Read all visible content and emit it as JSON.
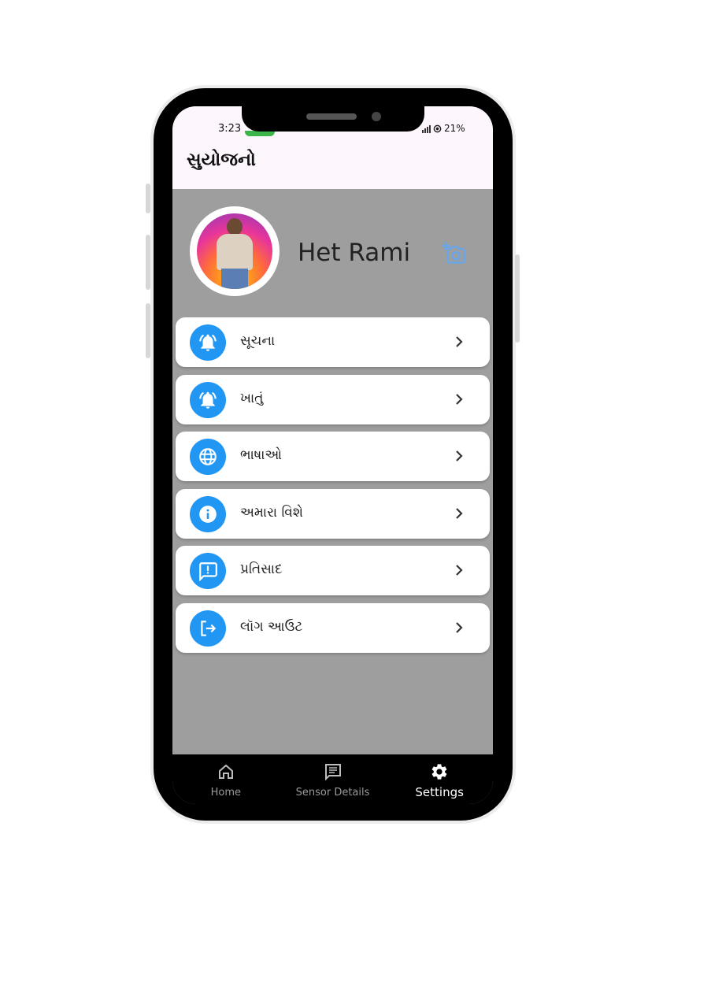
{
  "status_bar": {
    "time": "3:23",
    "battery": "21%"
  },
  "app_title": "સુયોજનો",
  "profile": {
    "name": "Het Rami",
    "add_photo_icon": "add-a-photo-icon"
  },
  "menu": [
    {
      "label": "સૂચના",
      "icon": "notifications-active-icon"
    },
    {
      "label": "ખાતું",
      "icon": "notifications-active-icon"
    },
    {
      "label": "ભાષાઓ",
      "icon": "language-icon"
    },
    {
      "label": "અમારા વિશે",
      "icon": "info-icon"
    },
    {
      "label": "પ્રતિસાદ",
      "icon": "feedback-icon"
    },
    {
      "label": "લૉગ આઉટ",
      "icon": "logout-icon"
    }
  ],
  "bottom_nav": [
    {
      "label": "Home",
      "icon": "home-icon",
      "active": false
    },
    {
      "label": "Sensor Details",
      "icon": "message-icon",
      "active": false
    },
    {
      "label": "Settings",
      "icon": "settings-icon",
      "active": true
    }
  ],
  "colors": {
    "accent": "#2196f3",
    "background": "#9e9e9e",
    "appbar": "#fdf6fc",
    "nav": "#000000"
  }
}
